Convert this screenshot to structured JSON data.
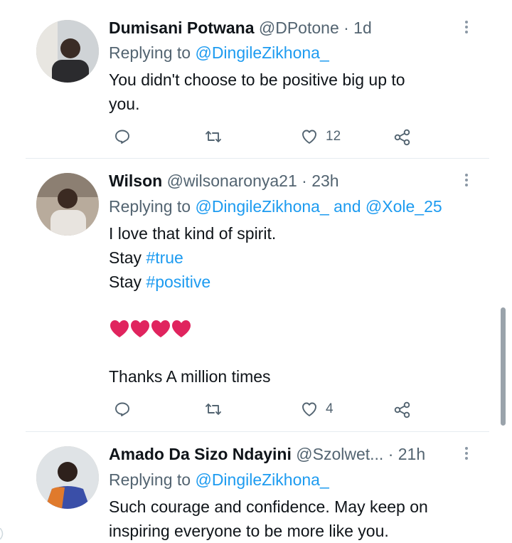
{
  "tweets": [
    {
      "name": "Dumisani Potwana",
      "handle": "@DPotone",
      "time": "· 1d",
      "replying_prefix": "Replying to",
      "replying_to": "@DingileZikhona_",
      "lines": [
        "You didn't choose to be positive big up to",
        "you."
      ],
      "likes": "12"
    },
    {
      "name": "Wilson",
      "handle": "@wilsonaronya21",
      "time": "· 23h",
      "replying_prefix": "Replying to",
      "replying_to": "@DingileZikhona_",
      "replying_and": "and",
      "replying_to_2": "@Xole_25",
      "line1": "I love that kind of spirit.",
      "stay1_prefix": "Stay",
      "stay1_tag": "#true",
      "stay2_prefix": "Stay",
      "stay2_tag": "#positive",
      "hearts": "❤❤❤❤",
      "closing": "Thanks A million times",
      "likes": "4"
    },
    {
      "name": "Amado Da Sizo Ndayini",
      "handle": "@Szolwet...",
      "time": "· 21h",
      "replying_prefix": "Replying to",
      "replying_to": "@DingileZikhona_",
      "lines": [
        "Such courage and confidence.  May keep on",
        "inspiring everyone to be more like you."
      ]
    }
  ],
  "icons": {
    "reply": "reply-icon",
    "retweet": "retweet-icon",
    "like": "heart-icon",
    "share": "share-icon",
    "more": "more-icon"
  },
  "colors": {
    "link": "#1d9bf0",
    "secondary_text": "#536471",
    "primary_text": "#0f1419",
    "heart": "#e0245e"
  }
}
